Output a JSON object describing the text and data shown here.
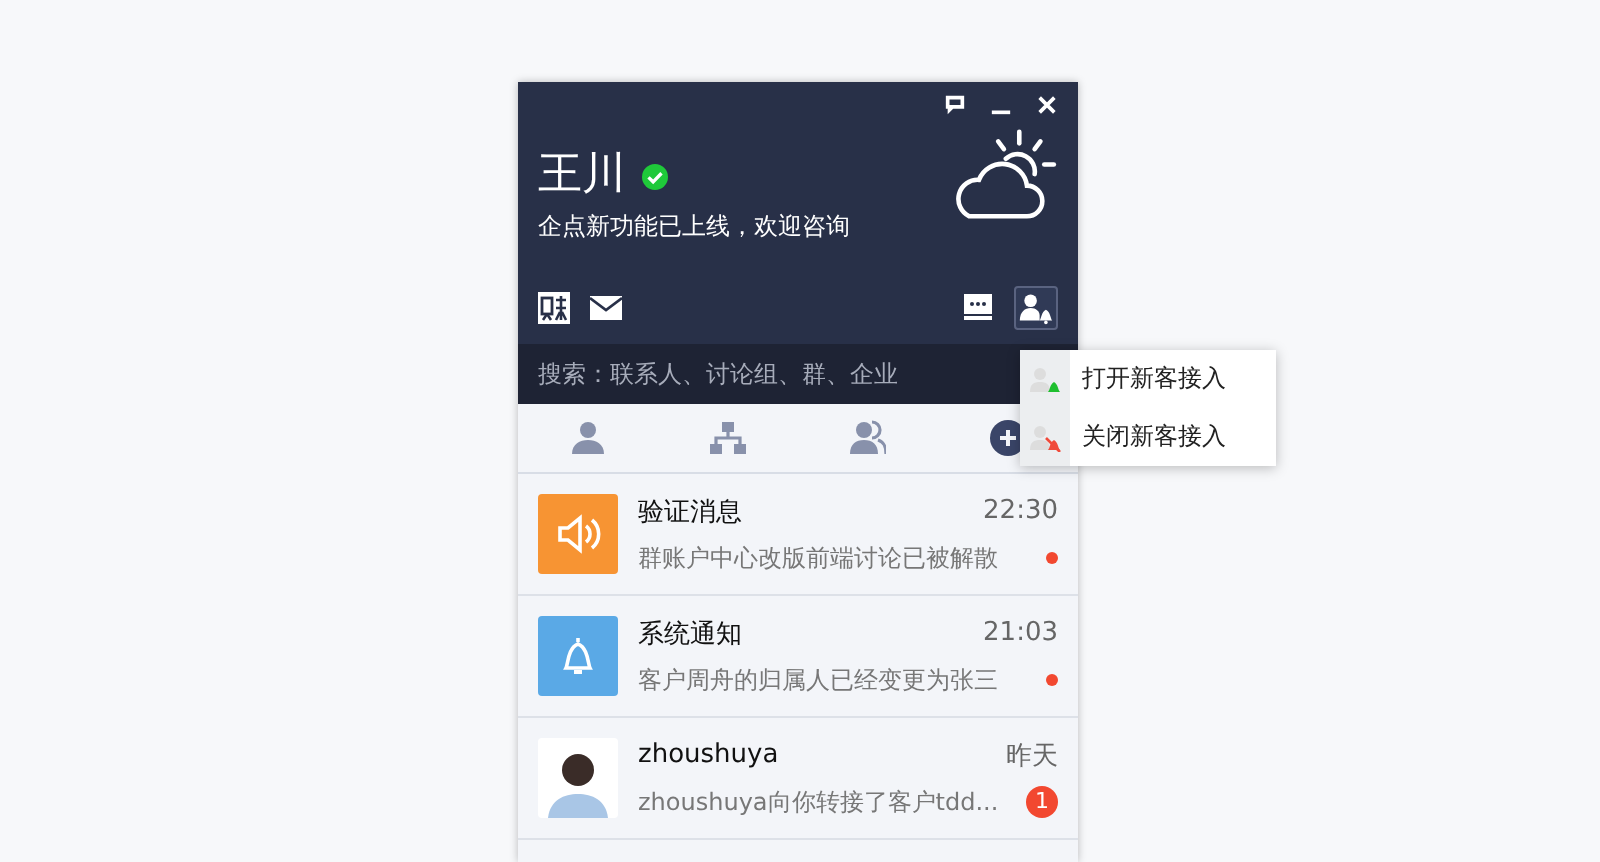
{
  "profile": {
    "name": "王川",
    "verified": true,
    "status_message": "企点新功能已上线，欢迎咨询"
  },
  "toolbar": {
    "notify_active": true
  },
  "search": {
    "placeholder": "搜索：联系人、讨论组、群、企业"
  },
  "tabs": [
    {
      "kind": "contact",
      "selected": false
    },
    {
      "kind": "org",
      "selected": false
    },
    {
      "kind": "group",
      "selected": false
    },
    {
      "kind": "more",
      "selected": true
    }
  ],
  "popup_menu": {
    "items": [
      {
        "kind": "open",
        "label": "打开新客接入"
      },
      {
        "kind": "close",
        "label": "关闭新客接入"
      }
    ]
  },
  "messages": [
    {
      "kind": "speaker",
      "title": "验证消息",
      "time": "22:30",
      "preview": "群账户中心改版前端讨论已被解散",
      "unread": {
        "kind": "dot"
      }
    },
    {
      "kind": "bell",
      "title": "系统通知",
      "time": "21:03",
      "preview": "客户周舟的归属人已经变更为张三",
      "unread": {
        "kind": "dot"
      }
    },
    {
      "kind": "photo",
      "title": "zhoushuya",
      "time": "昨天",
      "preview": "zhoushuya向你转接了客户tdd...",
      "unread": {
        "kind": "count",
        "count": "1"
      }
    }
  ]
}
